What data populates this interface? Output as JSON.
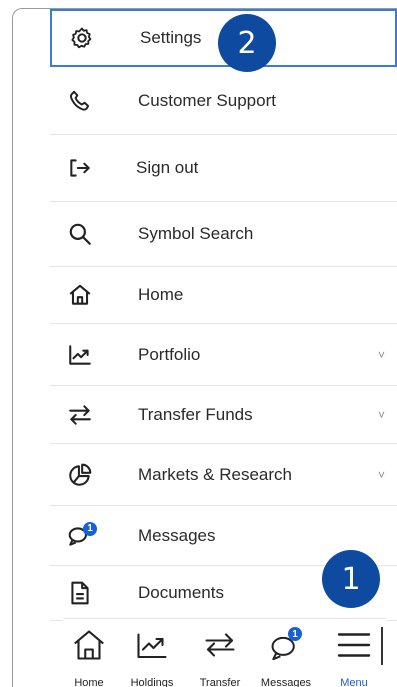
{
  "menu": {
    "items": [
      {
        "label": "Settings",
        "icon": "gear-icon"
      },
      {
        "label": "Customer Support",
        "icon": "phone-icon"
      },
      {
        "label": "Sign out",
        "icon": "sign-out-icon"
      },
      {
        "label": "Symbol Search",
        "icon": "search-icon"
      },
      {
        "label": "Home",
        "icon": "home-icon"
      },
      {
        "label": "Portfolio",
        "icon": "chart-up-icon",
        "chevron": "˅"
      },
      {
        "label": "Transfer Funds",
        "icon": "transfer-icon",
        "chevron": "˅"
      },
      {
        "label": "Markets & Research",
        "icon": "pie-chart-icon",
        "chevron": "˅"
      },
      {
        "label": "Messages",
        "icon": "chat-icon",
        "badge": "1"
      },
      {
        "label": "Documents",
        "icon": "document-icon"
      }
    ]
  },
  "bottom_nav": {
    "tabs": [
      {
        "label": "Home",
        "icon": "home-icon"
      },
      {
        "label": "Holdings",
        "icon": "chart-up-icon"
      },
      {
        "label": "Transfer",
        "icon": "transfer-icon"
      },
      {
        "label": "Messages",
        "icon": "chat-icon",
        "badge": "1"
      },
      {
        "label": "Menu",
        "icon": "hamburger-icon",
        "active": true
      }
    ]
  },
  "callouts": {
    "one": "1",
    "two": "2"
  },
  "colors": {
    "accent": "#1a5ecc",
    "callout": "#0e4aa0",
    "selected_border": "#3a7bd5"
  }
}
